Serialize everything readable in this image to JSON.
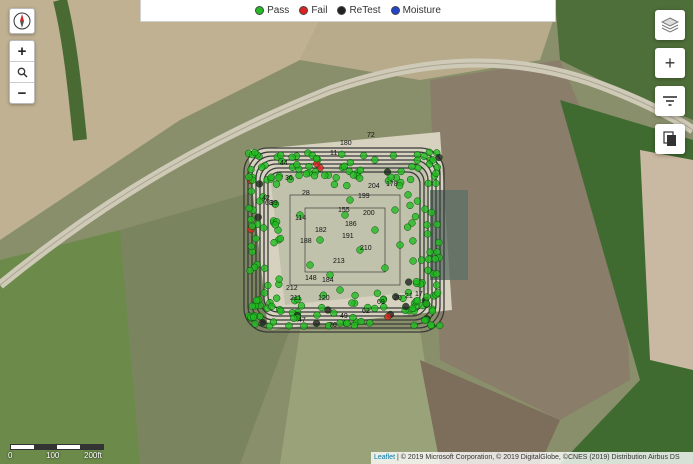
{
  "legend": {
    "items": [
      {
        "label": "Pass",
        "color": "#22bb22"
      },
      {
        "label": "Fail",
        "color": "#dd2222"
      },
      {
        "label": "ReTest",
        "color": "#222222"
      },
      {
        "label": "Moisture",
        "color": "#2244cc"
      }
    ]
  },
  "controls": {
    "zoom_in": "+",
    "zoom_reset_icon": "magnifier-icon",
    "zoom_out": "−",
    "layers_icon": "layers-icon",
    "add_label": "+",
    "filter_icon": "filter-icon",
    "copy_icon": "copy-icon"
  },
  "scale": {
    "labels": [
      "0",
      "100",
      "200ft"
    ]
  },
  "attribution": {
    "link": "Leaflet",
    "text": " | © 2019 Microsoft Corporation, © 2019 DigitalGlobe, ©CNES (2019) Distribution Airbus DS"
  },
  "point_labels": [
    "180",
    "72",
    "11",
    "44",
    "36",
    "204",
    "178",
    "199",
    "28",
    "114",
    "186",
    "200",
    "182",
    "155",
    "68",
    "191",
    "213",
    "210",
    "148",
    "184",
    "212",
    "211",
    "120",
    "47",
    "49",
    "76",
    "62",
    "69",
    "20",
    "21",
    "17",
    "42",
    "39",
    "188"
  ]
}
